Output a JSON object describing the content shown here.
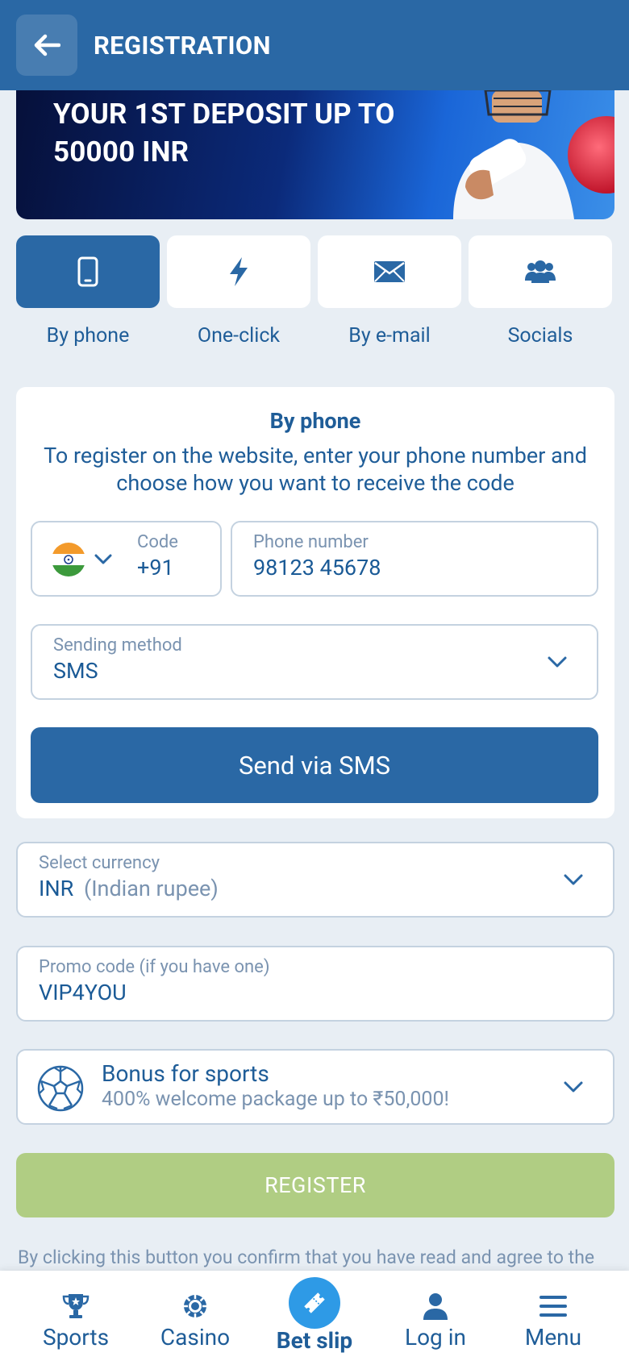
{
  "header": {
    "title": "REGISTRATION"
  },
  "banner": {
    "line1": "YOUR 1ST DEPOSIT UP TO",
    "line2": "50000 INR"
  },
  "tabs": [
    {
      "label": "By phone",
      "icon": "phone-icon",
      "active": true
    },
    {
      "label": "One-click",
      "icon": "lightning-icon",
      "active": false
    },
    {
      "label": "By e-mail",
      "icon": "envelope-icon",
      "active": false
    },
    {
      "label": "Socials",
      "icon": "people-icon",
      "active": false
    }
  ],
  "phone_form": {
    "title": "By phone",
    "description": "To register on the website, enter your phone number and choose how you want to receive the code",
    "code_label": "Code",
    "code_value": "+91",
    "phone_label": "Phone number",
    "phone_value": "98123 45678",
    "method_label": "Sending method",
    "method_value": "SMS",
    "send_button": "Send via SMS"
  },
  "currency": {
    "label": "Select currency",
    "code": "INR",
    "name": "(Indian rupee)"
  },
  "promo": {
    "label": "Promo code (if you have one)",
    "value": "VIP4YOU"
  },
  "bonus": {
    "title": "Bonus for sports",
    "subtitle": "400% welcome package up to ₹50,000!"
  },
  "register_button": "REGISTER",
  "disclaimer": "By clicking this button you confirm that you have read and agree to the",
  "bottom_nav": {
    "sports": "Sports",
    "casino": "Casino",
    "betslip": "Bet slip",
    "login": "Log in",
    "menu": "Menu"
  },
  "colors": {
    "primary": "#2a68a5",
    "background": "#e8eef4",
    "register_disabled": "#b0cd83",
    "betslip_accent": "#2e9ae6"
  }
}
